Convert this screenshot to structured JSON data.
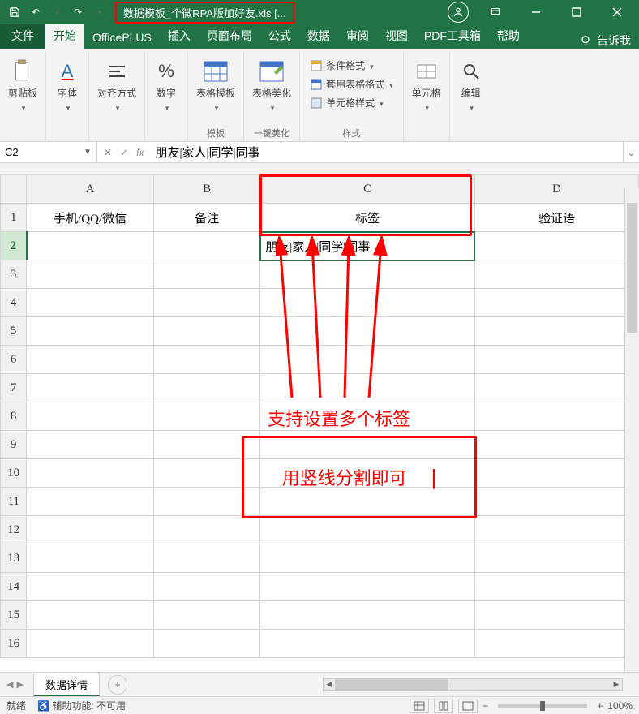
{
  "titlebar": {
    "filename": "数据模板_个微RPA版加好友.xls  [...",
    "qat": {
      "save": "💾",
      "undo": "↶",
      "redo": "↷",
      "more": "▾",
      "customize": "▾"
    }
  },
  "tabs": {
    "file": "文件",
    "home": "开始",
    "officeplus": "OfficePLUS",
    "insert": "插入",
    "pagelayout": "页面布局",
    "formulas": "公式",
    "data": "数据",
    "review": "审阅",
    "view": "视图",
    "pdftool": "PDF工具箱",
    "help": "帮助",
    "tellme": "告诉我"
  },
  "ribbon": {
    "clipboard": {
      "label": "剪贴板",
      "btn": "剪贴板"
    },
    "font": {
      "label": "字体",
      "btn": "字体",
      "glyph": "A"
    },
    "alignment": {
      "label": "对齐方式",
      "btn": "对齐方式"
    },
    "number": {
      "label": "数字",
      "btn": "数字",
      "glyph": "%"
    },
    "template": {
      "group": "模板",
      "btn": "表格模板"
    },
    "beautify": {
      "group": "一键美化",
      "btn": "表格美化"
    },
    "styles": {
      "group": "样式",
      "conditional": "条件格式",
      "tableformat": "套用表格格式",
      "cellstyle": "单元格样式"
    },
    "cells": {
      "label": "单元格",
      "btn": "单元格"
    },
    "editing": {
      "label": "编辑",
      "btn": "编辑"
    }
  },
  "fxbar": {
    "namebox": "C2",
    "cancel": "✕",
    "confirm": "✓",
    "fx": "fx",
    "formula": "朋友|家人|同学|同事"
  },
  "grid": {
    "cols": [
      "A",
      "B",
      "C",
      "D"
    ],
    "headers": {
      "A": "手机/QQ/微信",
      "B": "备注",
      "C": "标签",
      "D": "验证语"
    },
    "c2": "朋友|家人|同学|同事",
    "rows": [
      1,
      2,
      3,
      4,
      5,
      6,
      7,
      8,
      9,
      10,
      11,
      12,
      13,
      14,
      15,
      16
    ]
  },
  "annotations": {
    "multi_tag": "支持设置多个标签",
    "split_hint": "用竖线分割即可",
    "bar": "|"
  },
  "sheettabs": {
    "sheet1": "数据详情",
    "add": "+"
  },
  "statusbar": {
    "ready": "就绪",
    "accessibility": "辅助功能: 不可用",
    "zoom": "100%",
    "minus": "−",
    "plus": "+"
  }
}
